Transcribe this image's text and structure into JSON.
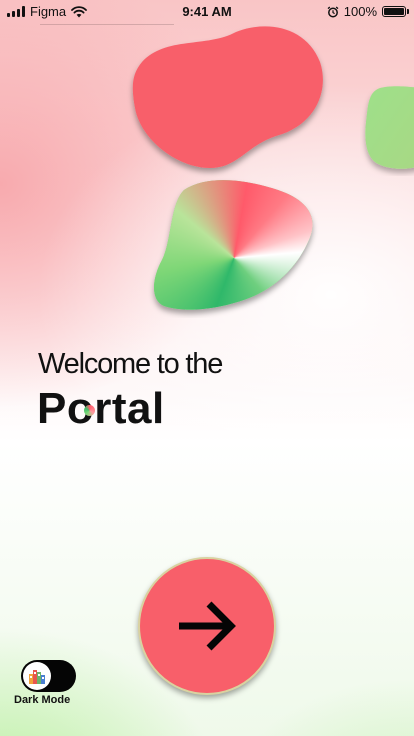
{
  "status_bar": {
    "carrier": "Figma",
    "time": "9:41 AM",
    "battery_text": "100%",
    "battery_level": 1.0,
    "icons": [
      "signal-icon",
      "wifi-icon",
      "alarm-icon",
      "battery-icon"
    ]
  },
  "hero": {
    "welcome": "Welcome to the",
    "title": "Portal"
  },
  "actions": {
    "next_icon": "arrow-right-icon"
  },
  "settings": {
    "dark_mode_label": "Dark Mode",
    "dark_mode_on": false,
    "toggle_icon": "city-icon"
  },
  "colors": {
    "accent_red": "#f85f6a",
    "accent_green": "#3fbe6b",
    "text": "#111111",
    "toggle_track": "#050505"
  }
}
